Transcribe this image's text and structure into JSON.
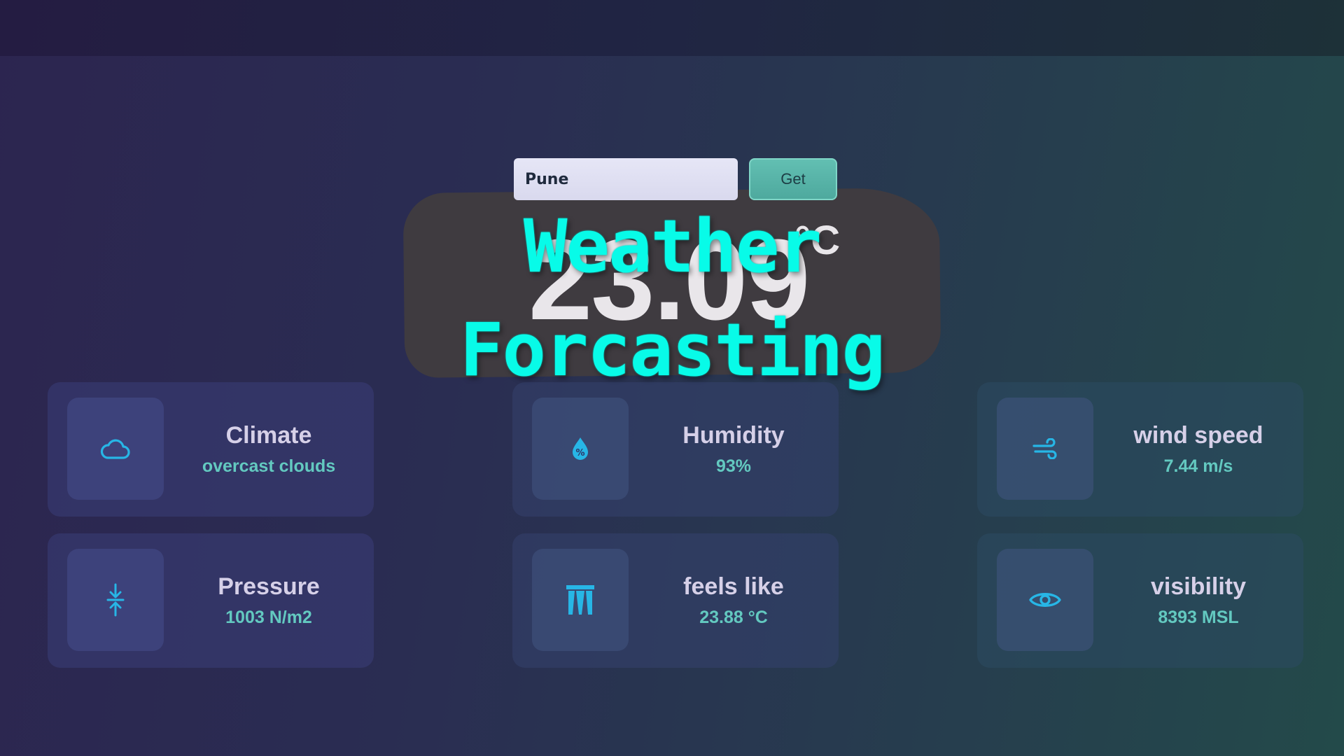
{
  "search": {
    "value": "Pune",
    "button_label": "Get"
  },
  "temperature": {
    "value": "23.09",
    "unit": "°C"
  },
  "overlay": {
    "line1": "Weather",
    "line2": "Forcasting"
  },
  "cards": [
    {
      "label": "Climate",
      "value": "overcast clouds",
      "icon": "cloud-icon"
    },
    {
      "label": "Humidity",
      "value": "93%",
      "icon": "humidity-drop-icon"
    },
    {
      "label": "wind speed",
      "value": "7.44 m/s",
      "icon": "wind-icon"
    },
    {
      "label": "Pressure",
      "value": "1003 N/m2",
      "icon": "pressure-arrows-icon"
    },
    {
      "label": "feels like",
      "value": "23.88 °C",
      "icon": "feels-like-icon"
    },
    {
      "label": "visibility",
      "value": "8393 MSL",
      "icon": "eye-icon"
    }
  ],
  "colors": {
    "accent": "#08fbe8",
    "value_text": "#63c9c0",
    "icon": "#27b6e6"
  }
}
